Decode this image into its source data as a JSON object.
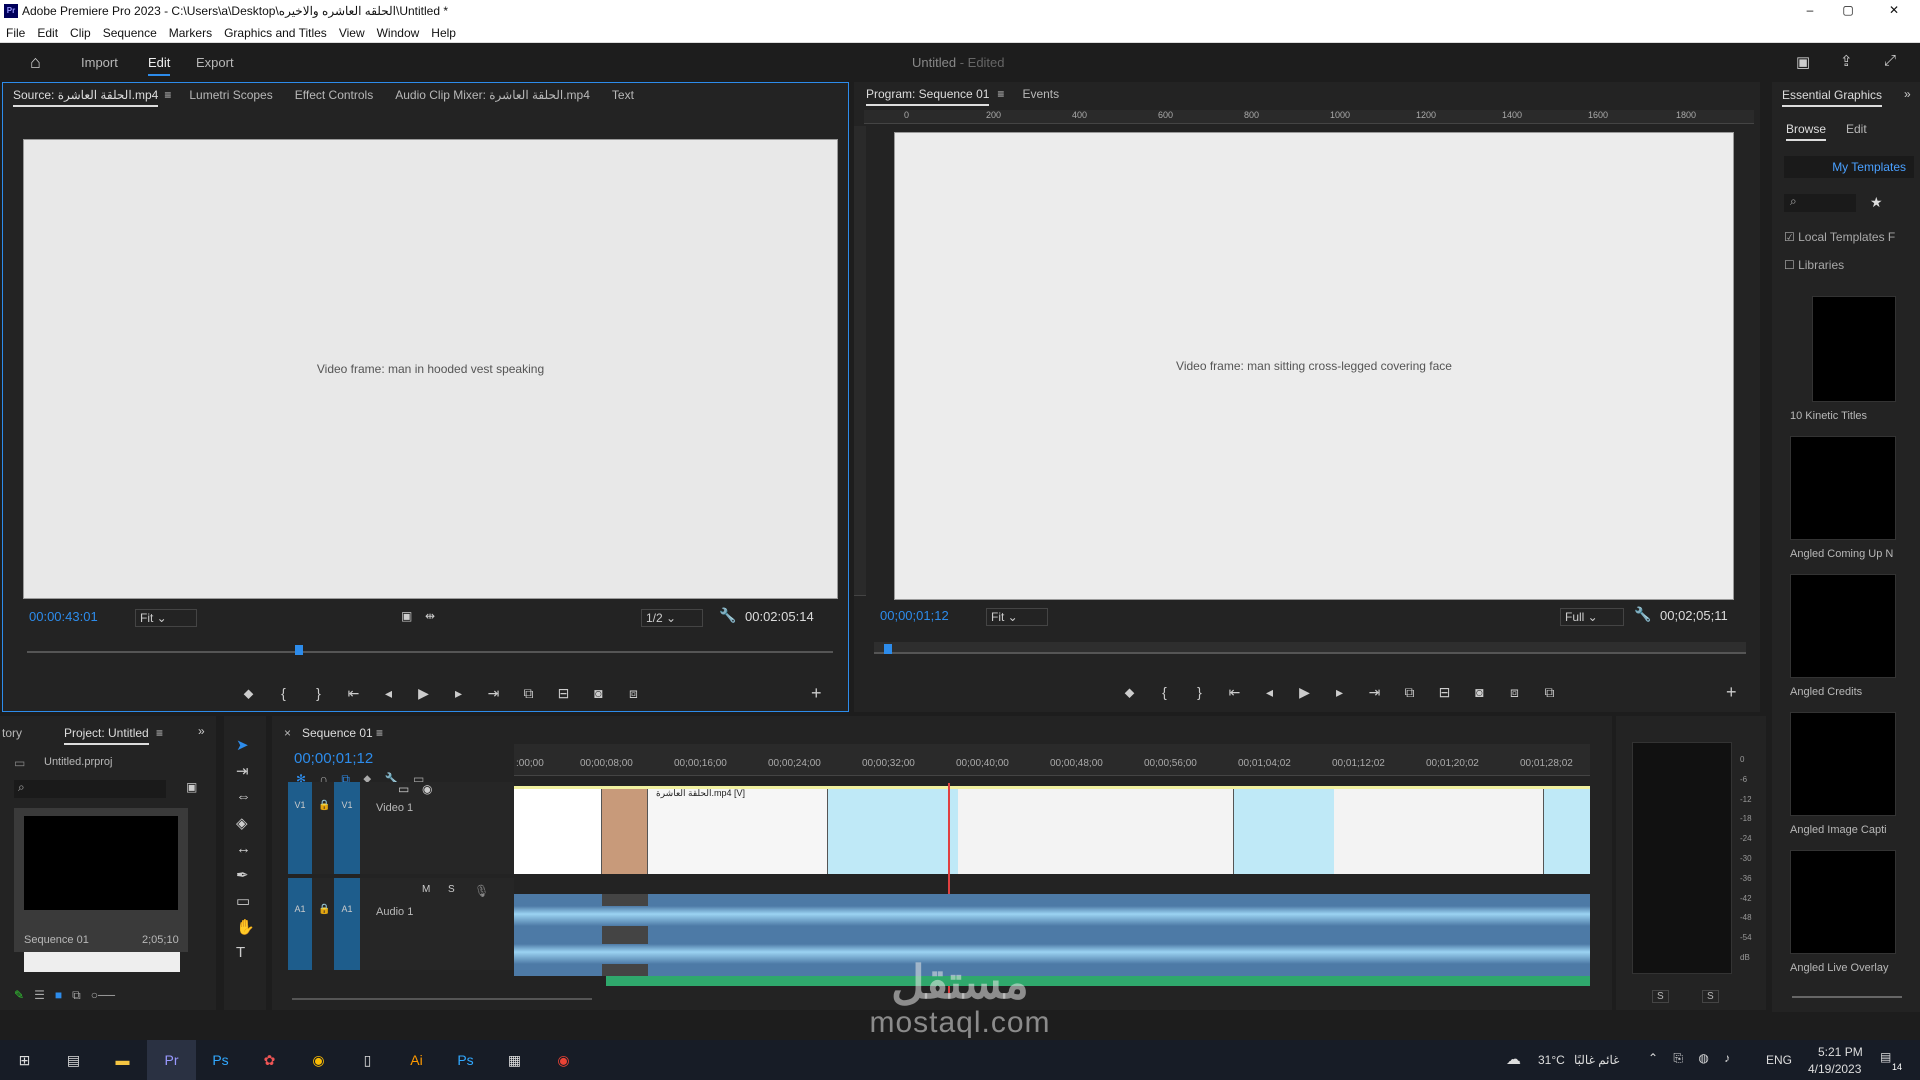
{
  "title_bar": {
    "title": "Adobe Premiere Pro 2023 - C:\\Users\\a\\Desktop\\الحلقه العاشره والاخيره\\Untitled *",
    "app_icon": "Pr",
    "minimize": "–",
    "maximize": "▢",
    "close": "✕"
  },
  "menu": [
    "File",
    "Edit",
    "Clip",
    "Sequence",
    "Markers",
    "Graphics and Titles",
    "View",
    "Window",
    "Help"
  ],
  "workspace": {
    "tabs": [
      "Import",
      "Edit",
      "Export"
    ],
    "active": "Edit",
    "project_title": "Untitled",
    "project_status": "- Edited"
  },
  "source_panel": {
    "tabs": [
      "Source: الحلقة العاشرة.mp4",
      "Lumetri Scopes",
      "Effect Controls",
      "Audio Clip Mixer: الحلقة العاشرة.mp4",
      "Text"
    ],
    "timecode": "00:00:43:01",
    "fit": "Fit",
    "resolution": "1/2",
    "duration": "00:02:05:14",
    "image_label": "Video frame: man in hooded vest speaking"
  },
  "program_panel": {
    "tabs": [
      "Program: Sequence 01",
      "Events"
    ],
    "ruler_ticks": [
      "0",
      "200",
      "400",
      "600",
      "800",
      "1000",
      "1200",
      "1400",
      "1600",
      "1800"
    ],
    "timecode": "00;00;01;12",
    "fit": "Fit",
    "resolution": "Full",
    "duration": "00;02;05;11",
    "image_label": "Video frame: man sitting cross-legged covering face"
  },
  "essential_graphics": {
    "title": "Essential Graphics",
    "tabs": [
      "Browse",
      "Edit"
    ],
    "my_templates": "My Templates",
    "local_templates": "Local Templates F",
    "libraries": "Libraries",
    "templates": [
      "10 Kinetic Titles",
      "Angled Coming Up N",
      "Angled Credits",
      "Angled Image Capti",
      "Angled Live Overlay"
    ]
  },
  "project_panel": {
    "tabs": [
      "tory",
      "Project: Untitled"
    ],
    "file": "Untitled.prproj",
    "sequence_name": "Sequence 01",
    "sequence_duration": "2;05;10"
  },
  "timeline": {
    "sequence_tab": "Sequence 01",
    "timecode": "00;00;01;12",
    "ruler": [
      ":00;00",
      "00;00;08;00",
      "00;00;16;00",
      "00;00;24;00",
      "00;00;32;00",
      "00;00;40;00",
      "00;00;48;00",
      "00;00;56;00",
      "00;01;04;02",
      "00;01;12;02",
      "00;01;20;02",
      "00;01;28;02"
    ],
    "video_track": {
      "name": "Video 1",
      "label": "V1"
    },
    "audio_track": {
      "name": "Audio 1",
      "label": "A1"
    },
    "clip_label": "الحلقة العاشرة.mp4 [V]"
  },
  "audio_meter": {
    "scale": [
      "0",
      "-6",
      "-12",
      "-18",
      "-24",
      "-30",
      "-36",
      "-42",
      "-48",
      "-54",
      "dB"
    ],
    "solo": [
      "S",
      "S"
    ]
  },
  "taskbar": {
    "weather": "31°C",
    "weather_text": "غائم غالبًا",
    "lang": "ENG",
    "time": "5:21 PM",
    "date": "4/19/2023",
    "notifications": "14"
  },
  "watermark": {
    "arabic": "مستقل",
    "site": "mostaql.com"
  }
}
